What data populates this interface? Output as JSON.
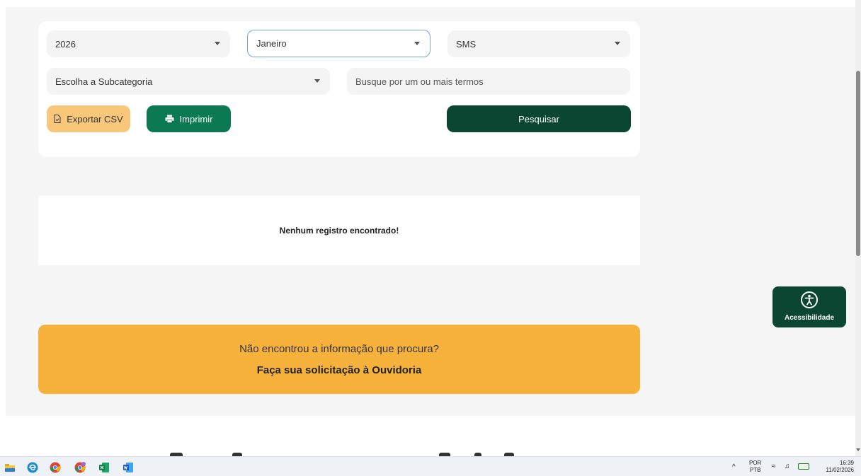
{
  "filters": {
    "year": "2026",
    "month": "Janeiro",
    "category": "SMS",
    "subcategory_placeholder": "Escolha a Subcategoria",
    "search_placeholder": "Busque por um ou mais termos"
  },
  "actions": {
    "export_label": "Exportar CSV",
    "print_label": "Imprimir",
    "search_label": "Pesquisar"
  },
  "results": {
    "empty_message": "Nenhum registro encontrado!"
  },
  "ouvidoria": {
    "question": "Não encontrou a informação que procura?",
    "link": "Faça sua solicitação à Ouvidoria"
  },
  "accessibility": {
    "label": "Acessibilidade"
  },
  "taskbar": {
    "lang_top": "POR",
    "lang_bottom": "PTB",
    "time": "16:39",
    "date": "11/02/2026",
    "apps": [
      "file-explorer-icon",
      "edge-icon",
      "chrome-icon",
      "chrome-profile-icon",
      "excel-icon",
      "word-icon"
    ]
  },
  "colors": {
    "primary_dark": "#0b4633",
    "primary": "#0b7a52",
    "accent_yellow": "#f7b23b",
    "csv_yellow": "#f8c77a"
  }
}
